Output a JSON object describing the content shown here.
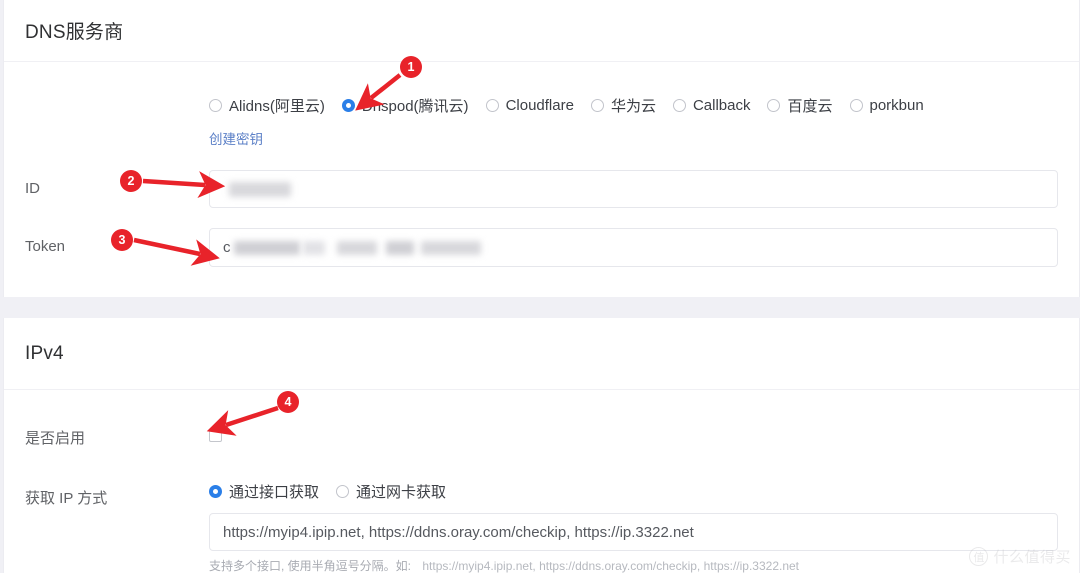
{
  "sections": {
    "dns": {
      "title": "DNS服务商",
      "provider_row": {
        "options": [
          {
            "label": "Alidns(阿里云)",
            "checked": false
          },
          {
            "label": "Dnspod(腾讯云)",
            "checked": true
          },
          {
            "label": "Cloudflare",
            "checked": false
          },
          {
            "label": "华为云",
            "checked": false
          },
          {
            "label": "Callback",
            "checked": false
          },
          {
            "label": "百度云",
            "checked": false
          },
          {
            "label": "porkbun",
            "checked": false
          }
        ],
        "create_key_link": "创建密钥"
      },
      "id_row": {
        "label": "ID",
        "value_prefix": "",
        "value_redacted": true
      },
      "token_row": {
        "label": "Token",
        "value_prefix": "c",
        "value_redacted": true
      }
    },
    "ipv4": {
      "title": "IPv4",
      "enable_row": {
        "label": "是否启用",
        "checked": false
      },
      "method_row": {
        "label": "获取 IP 方式",
        "options": [
          {
            "label": "通过接口获取",
            "checked": true
          },
          {
            "label": "通过网卡获取",
            "checked": false
          }
        ],
        "input_value": "https://myip4.ipip.net, https://ddns.oray.com/checkip, https://ip.3322.net",
        "input_placeholder": "https://myip4.ipip.net",
        "help_prefix": "支持多个接口, 使用半角逗号分隔。如:",
        "help_example": "https://myip4.ipip.net, https://ddns.oray.com/checkip, https://ip.3322.net"
      }
    }
  },
  "annotations": [
    {
      "number": "1"
    },
    {
      "number": "2"
    },
    {
      "number": "3"
    },
    {
      "number": "4"
    }
  ],
  "watermark": {
    "mark": "值",
    "text": "什么值得买"
  },
  "colors": {
    "accent": "#2b7fe8",
    "annotation": "#e8232a",
    "link": "#5c80c7",
    "page_bg": "#f0f0f5",
    "card_bg": "#ffffff"
  }
}
